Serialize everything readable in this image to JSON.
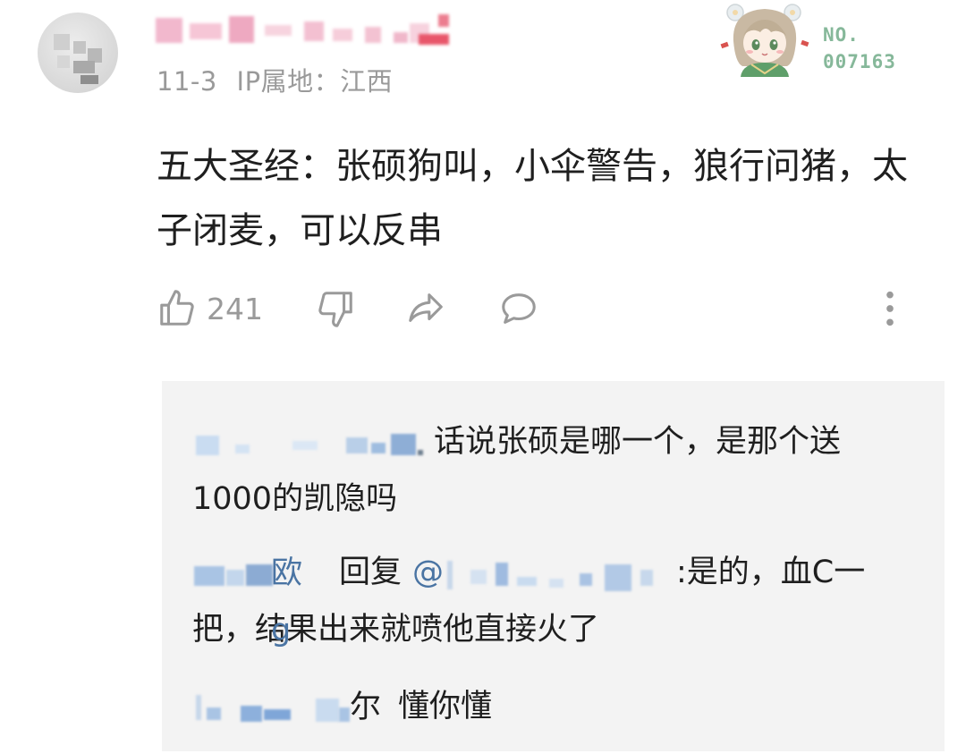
{
  "comment": {
    "date": "11-3",
    "ip_label": "IP属地：江西",
    "content": "五大圣经：张硕狗叫，小伞警告，狼行问猪，太子闭麦，可以反串",
    "badge": {
      "no_label": "NO.",
      "number": "007163"
    },
    "actions": {
      "like_count": "241",
      "like_icon": "thumbs-up-icon",
      "dislike_icon": "thumbs-down-icon",
      "share_icon": "share-icon",
      "reply_icon": "comment-icon",
      "more_icon": "more-vertical-icon"
    }
  },
  "replies": [
    {
      "author_suffix": "",
      "text": "话说张硕是哪一个，是那个送1000的凯隐吗"
    },
    {
      "author_suffix": "欧g",
      "reply_word": "回复",
      "mention_prefix": "@",
      "text": ":是的，血C一把，结果出来就喷他直接火了"
    },
    {
      "author_suffix": "尔",
      "text": "懂你懂"
    }
  ],
  "colors": {
    "text": "#1f1f1f",
    "meta": "#9a9a9a",
    "link": "#4a74a3",
    "reply_bg": "#f3f3f3",
    "badge": "#86b89a"
  }
}
